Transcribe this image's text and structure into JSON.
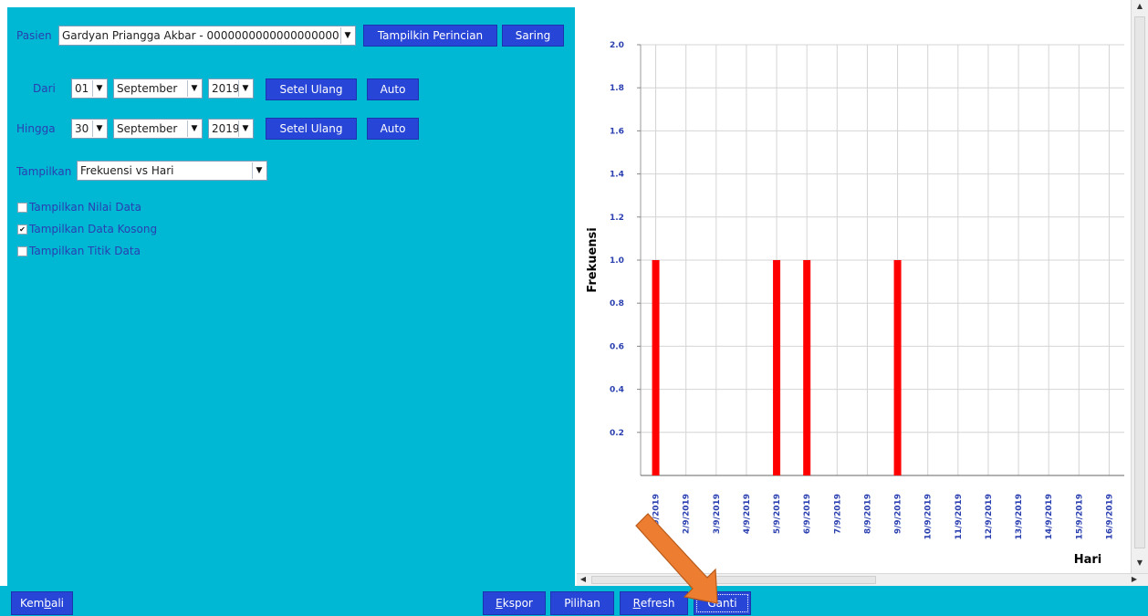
{
  "filters": {
    "patient_label": "Pasien",
    "patient_value": "Gardyan Priangga Akbar - 0000000000000000000",
    "show_details_button": "Tampilkin Perincian",
    "filter_button": "Saring",
    "from_label": "Dari",
    "from_day": "01",
    "from_month": "September",
    "from_year": "2019",
    "to_label": "Hingga",
    "to_day": "30",
    "to_month": "September",
    "to_year": "2019",
    "reset_button": "Setel Ulang",
    "auto_button": "Auto",
    "display_label": "Tampilkan",
    "display_value": "Frekuensi vs Hari",
    "checkboxes": [
      {
        "label": "Tampilkan Nilai Data",
        "checked": false
      },
      {
        "label": "Tampilkan Data Kosong",
        "checked": true
      },
      {
        "label": "Tampilkan Titik Data",
        "checked": false
      }
    ]
  },
  "chart_data": {
    "type": "bar",
    "ylabel": "Frekuensi",
    "xlabel": "Hari",
    "ylim": [
      0,
      2.0
    ],
    "yticks": [
      "0.2",
      "0.4",
      "0.6",
      "0.8",
      "1.0",
      "1.2",
      "1.4",
      "1.6",
      "1.8",
      "2.0"
    ],
    "categories": [
      "1/9/2019",
      "2/9/2019",
      "3/9/2019",
      "4/9/2019",
      "5/9/2019",
      "6/9/2019",
      "7/9/2019",
      "8/9/2019",
      "9/9/2019",
      "10/9/2019",
      "11/9/2019",
      "12/9/2019",
      "13/9/2019",
      "14/9/2019",
      "15/9/2019",
      "16/9/2019"
    ],
    "values": [
      1,
      0,
      0,
      0,
      1,
      1,
      0,
      0,
      1,
      0,
      0,
      0,
      0,
      0,
      0,
      0
    ],
    "bar_color": "#ff0000",
    "grid": true
  },
  "bottom": {
    "back": {
      "pre": "Kem",
      "acc": "b",
      "post": "ali"
    },
    "export": {
      "pre": "",
      "acc": "E",
      "post": "kspor"
    },
    "options": {
      "pre": "Pilihan",
      "acc": "",
      "post": ""
    },
    "refresh": {
      "pre": "",
      "acc": "R",
      "post": "efresh"
    },
    "change": {
      "pre": "Ganti",
      "acc": "",
      "post": ""
    }
  },
  "colors": {
    "panel": "#00B8D4",
    "button": "#2745d6",
    "label": "#2a3fb0",
    "arrow": "#ED7D31"
  }
}
